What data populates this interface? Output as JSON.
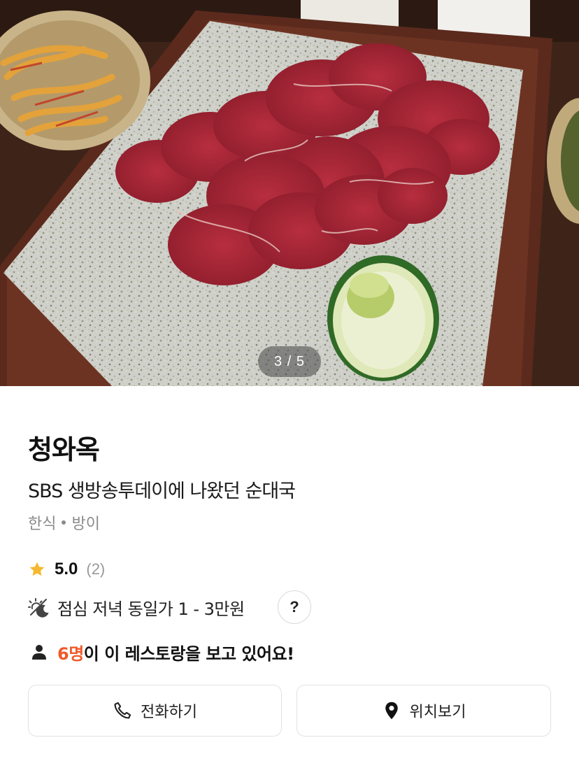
{
  "gallery": {
    "counter": "3 / 5"
  },
  "restaurant": {
    "name": "청와옥",
    "description": "SBS 생방송투데이에 나왔던 순대국",
    "cuisine": "한식",
    "area": "방이",
    "rating": "5.0",
    "review_count": "(2)",
    "price_text": "점심 저녁 동일가 1 - 3만원",
    "help_label": "?",
    "viewers_count": "6명",
    "viewers_text": "이 이 레스토랑을 보고 있어요!"
  },
  "actions": {
    "call_label": "전화하기",
    "map_label": "위치보기"
  },
  "colors": {
    "accent": "#ef5a2a",
    "star": "#f5b82e",
    "muted": "#8a8a8a",
    "border": "#e2e2e2"
  },
  "icons": {
    "rating": "star-icon",
    "price": "sun-moon-icon",
    "viewers": "person-icon",
    "call": "phone-icon",
    "map": "location-pin-icon"
  }
}
